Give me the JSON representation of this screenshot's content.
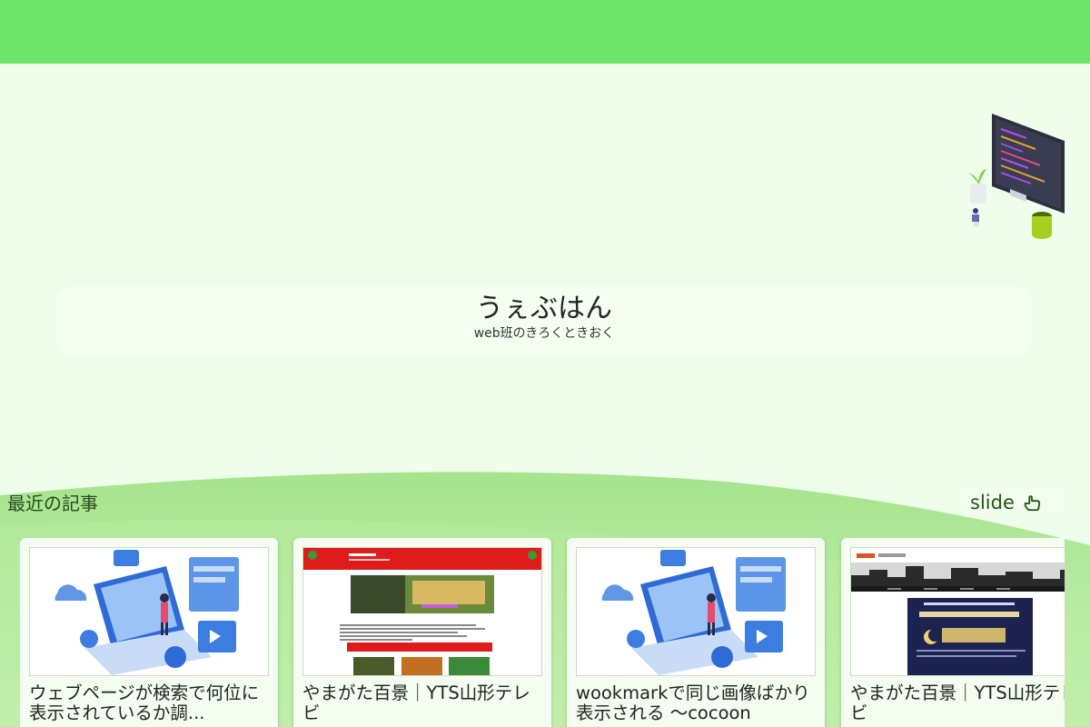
{
  "header": {
    "color": "#6ee469"
  },
  "site": {
    "title": "うぇぶはん",
    "subtitle": "web班のきろくときおく"
  },
  "recent": {
    "heading": "最近の記事",
    "slide_label": "slide",
    "slide_icon": "hand-pointing-icon"
  },
  "cards": [
    {
      "title": "ウェブページが検索で何位に表示されているか調...",
      "thumb": "cms-illustration"
    },
    {
      "title": "やまがた百景｜YTS山形テレビ",
      "thumb": "yamagata-site-screenshot"
    },
    {
      "title": "wookmarkで同じ画像ばかり表示される 〜cocoon",
      "thumb": "cms-illustration"
    },
    {
      "title": "やまがた百景｜YTS山形テレビ",
      "thumb": "night-poster-screenshot"
    }
  ]
}
